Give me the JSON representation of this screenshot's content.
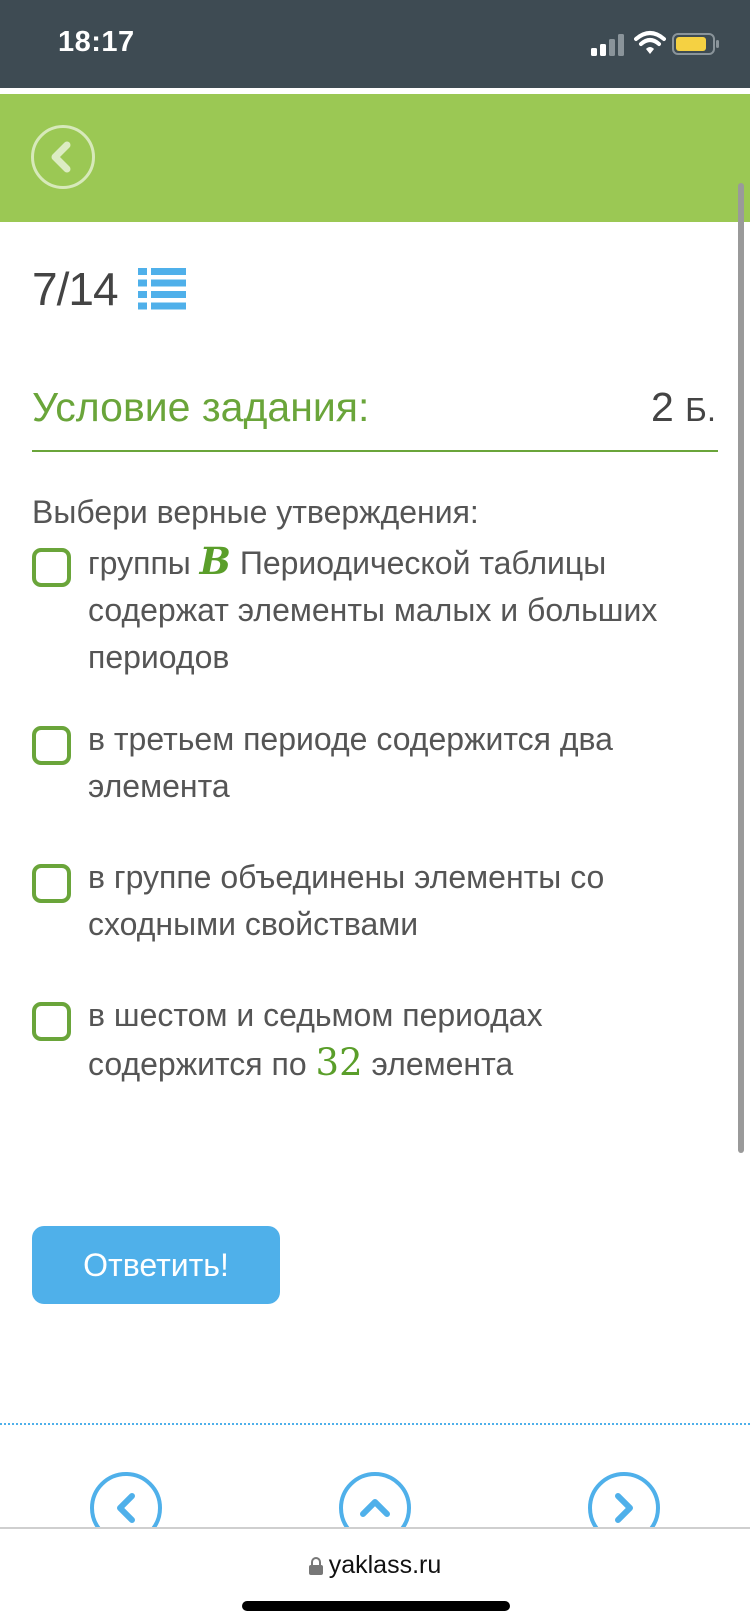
{
  "status_bar": {
    "time": "18:17"
  },
  "header": {
    "back_icon": "chevron-left-circle-icon"
  },
  "counter": {
    "text": "7/14",
    "icon": "list-icon"
  },
  "condition": {
    "title": "Условие задания:",
    "points_value": "2",
    "points_unit": "Б."
  },
  "instruction": "Выбери верные утверждения:",
  "options": [
    {
      "before": "группы ",
      "math": "B",
      "after": " Периодической таблицы содержат элементы малых и больших периодов"
    },
    {
      "text": "в третьем периоде содержится два элемента"
    },
    {
      "text": "в группе объединены элементы со сходными свойствами"
    },
    {
      "before": "в шестом и седьмом периодах содержится по ",
      "math": "32",
      "after": " элемента"
    }
  ],
  "submit_label": "Ответить!",
  "nav": {
    "prev_icon": "chevron-left-icon",
    "up_icon": "chevron-up-icon",
    "next_icon": "chevron-right-icon"
  },
  "browser": {
    "url": "yaklass.ru"
  },
  "colors": {
    "header_green": "#9bc854",
    "accent_green": "#6aa53a",
    "button_blue": "#4fb0ea",
    "status_bar": "#3e4b53"
  }
}
